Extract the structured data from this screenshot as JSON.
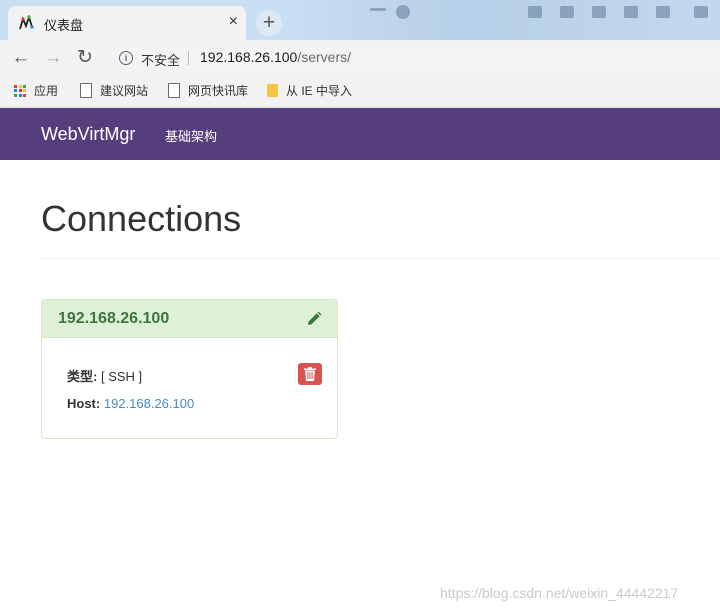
{
  "browser": {
    "tab": {
      "title": "仪表盘",
      "close": "×"
    },
    "new_tab": "+",
    "nav": {
      "back": "←",
      "forward": "→",
      "reload": "↻"
    },
    "address": {
      "security_label": "不安全",
      "host": "192.168.26.100",
      "path": "/servers/"
    },
    "bookmarks": [
      {
        "label": "应用",
        "icon": "apps-grid-icon"
      },
      {
        "label": "建议网站",
        "icon": "page-icon"
      },
      {
        "label": "网页快讯库",
        "icon": "page-icon"
      },
      {
        "label": "从 IE 中导入",
        "icon": "folder-icon"
      }
    ]
  },
  "app": {
    "brand": "WebVirtMgr",
    "nav_items": [
      "基础架构"
    ],
    "colors": {
      "navbar": "#563d7c",
      "panel_header": "#dff0d8",
      "panel_title": "#3c763d",
      "delete": "#d9534f",
      "link": "#428bca"
    }
  },
  "page": {
    "title": "Connections",
    "connections": [
      {
        "name": "192.168.26.100",
        "type_label": "类型:",
        "type_value": "[ SSH ]",
        "host_label": "Host:",
        "host_value": "192.168.26.100",
        "edit_icon": "pencil-icon",
        "delete_icon": "trash-icon"
      }
    ]
  },
  "watermark": "https://blog.csdn.net/weixin_44442217"
}
